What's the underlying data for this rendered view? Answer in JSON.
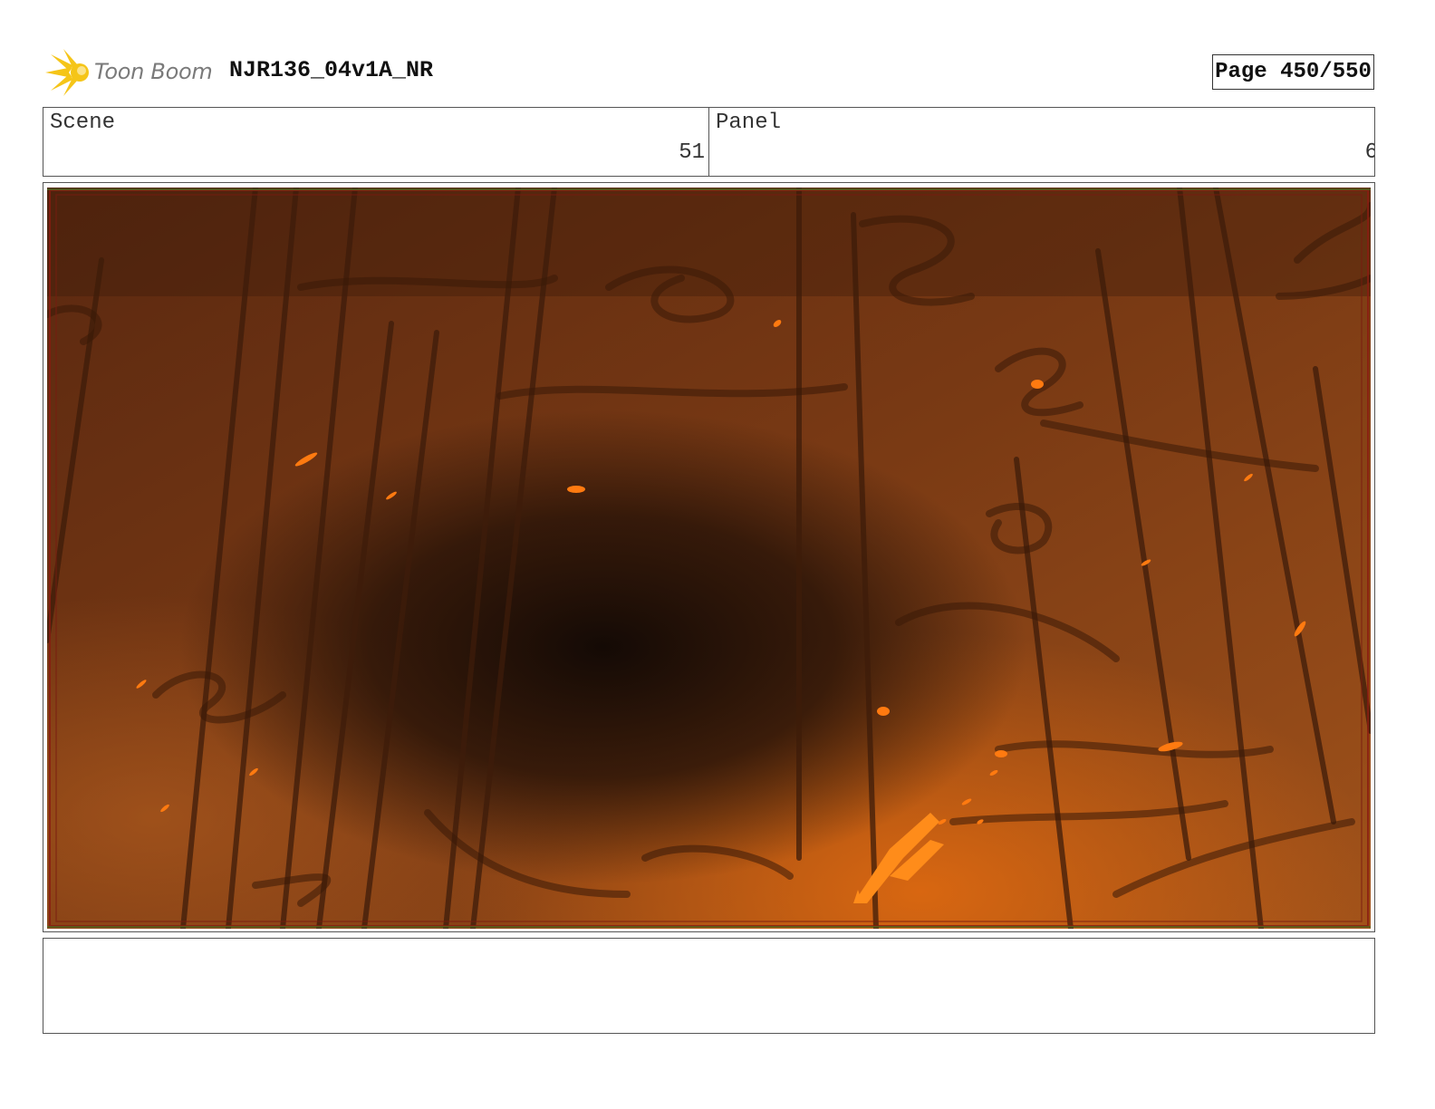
{
  "header": {
    "logo_text": "Toon Boom",
    "project_title": "NJR136_04v1A_NR",
    "page_label": "Page 450/550"
  },
  "info": {
    "scene_label": "Scene",
    "scene_value": "51",
    "panel_label": "Panel",
    "panel_value": "6"
  },
  "colors": {
    "logo_flash": "#f5c518",
    "artwork_dark": "#140a05",
    "artwork_mid": "#6e3512",
    "artwork_glow": "#d9650f",
    "ember": "#ff7a10"
  },
  "artwork": {
    "icon": "storyboard-frame-image"
  },
  "notes": {
    "text": ""
  }
}
